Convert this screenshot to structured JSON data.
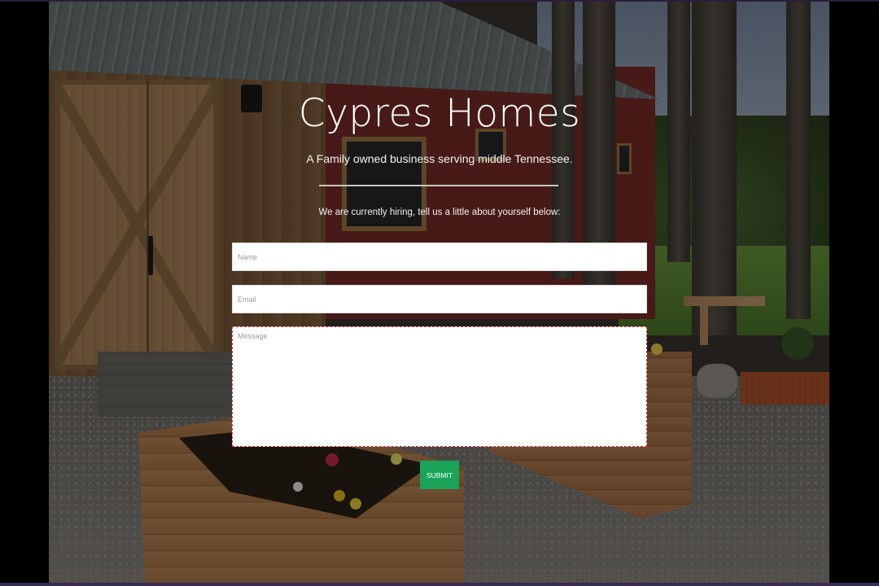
{
  "hero": {
    "title": "Cypres Homes",
    "subtitle": "A Family owned business serving middle Tennessee.",
    "hiring_text": "We are currently hiring, tell us a little about yourself below:"
  },
  "form": {
    "name_placeholder": "Name",
    "email_placeholder": "Email",
    "message_placeholder": "Message",
    "submit_label": "SUBMIT"
  },
  "colors": {
    "submit_bg": "#1aa45a",
    "message_border": "#c43c3c"
  }
}
